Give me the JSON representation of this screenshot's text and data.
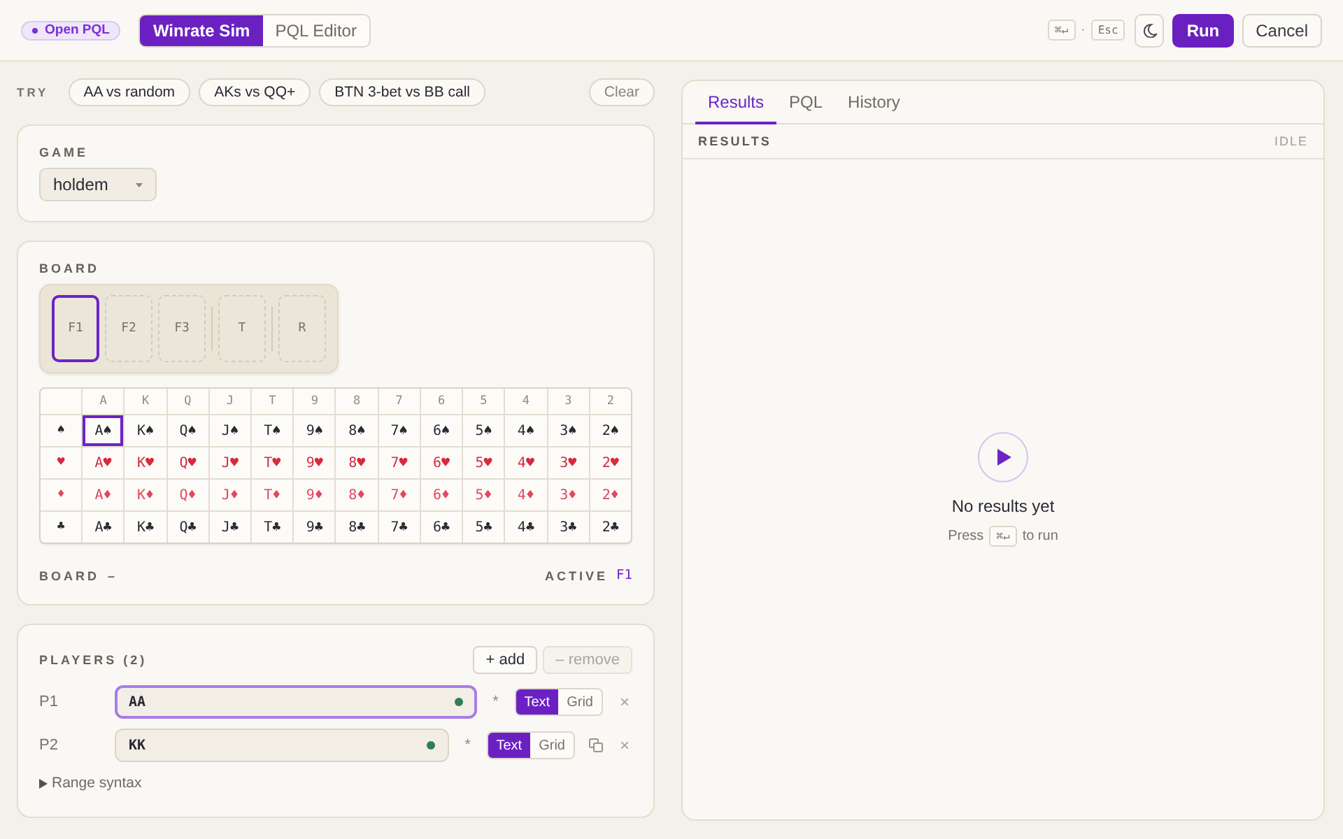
{
  "header": {
    "badge": {
      "label": "Open PQL"
    },
    "modes": [
      {
        "label": "Winrate Sim",
        "selected": true
      },
      {
        "label": "PQL Editor",
        "selected": false
      }
    ],
    "shortcuts": [
      "⌘↵",
      "Esc"
    ],
    "shortcut_separator": "·",
    "run_button": "Run",
    "cancel_button": "Cancel"
  },
  "try": {
    "label": "TRY",
    "examples": [
      "AA vs random",
      "AKs vs QQ+",
      "BTN 3-bet vs BB call"
    ],
    "clear_button": "Clear"
  },
  "game": {
    "label": "GAME",
    "value": "holdem"
  },
  "board": {
    "label": "BOARD",
    "slot_groups": [
      {
        "slots": [
          {
            "label": "F1",
            "selected": true
          },
          {
            "label": "F2",
            "selected": false
          },
          {
            "label": "F3",
            "selected": false
          }
        ]
      },
      {
        "slots": [
          {
            "label": "T",
            "selected": false
          }
        ]
      },
      {
        "slots": [
          {
            "label": "R",
            "selected": false
          }
        ]
      }
    ],
    "card_grid": {
      "columns": [
        "A",
        "K",
        "Q",
        "J",
        "T",
        "9",
        "8",
        "7",
        "6",
        "5",
        "4",
        "3",
        "2"
      ],
      "rows": [
        {
          "suit": "♠",
          "color": "#2b2a33",
          "cards": [
            {
              "label": "A♠",
              "selected": true
            },
            {
              "label": "K♠",
              "selected": false
            },
            {
              "label": "Q♠",
              "selected": false
            },
            {
              "label": "J♠",
              "selected": false
            },
            {
              "label": "T♠",
              "selected": false
            },
            {
              "label": "9♠",
              "selected": false
            },
            {
              "label": "8♠",
              "selected": false
            },
            {
              "label": "7♠",
              "selected": false
            },
            {
              "label": "6♠",
              "selected": false
            },
            {
              "label": "5♠",
              "selected": false
            },
            {
              "label": "4♠",
              "selected": false
            },
            {
              "label": "3♠",
              "selected": false
            },
            {
              "label": "2♠",
              "selected": false
            }
          ]
        },
        {
          "suit": "♥",
          "color": "#d6293f",
          "cards": [
            {
              "label": "A♥",
              "selected": false
            },
            {
              "label": "K♥",
              "selected": false
            },
            {
              "label": "Q♥",
              "selected": false
            },
            {
              "label": "J♥",
              "selected": false
            },
            {
              "label": "T♥",
              "selected": false
            },
            {
              "label": "9♥",
              "selected": false
            },
            {
              "label": "8♥",
              "selected": false
            },
            {
              "label": "7♥",
              "selected": false
            },
            {
              "label": "6♥",
              "selected": false
            },
            {
              "label": "5♥",
              "selected": false
            },
            {
              "label": "4♥",
              "selected": false
            },
            {
              "label": "3♥",
              "selected": false
            },
            {
              "label": "2♥",
              "selected": false
            }
          ]
        },
        {
          "suit": "♦",
          "color": "#e2475d",
          "cards": [
            {
              "label": "A♦",
              "selected": false
            },
            {
              "label": "K♦",
              "selected": false
            },
            {
              "label": "Q♦",
              "selected": false
            },
            {
              "label": "J♦",
              "selected": false
            },
            {
              "label": "T♦",
              "selected": false
            },
            {
              "label": "9♦",
              "selected": false
            },
            {
              "label": "8♦",
              "selected": false
            },
            {
              "label": "7♦",
              "selected": false
            },
            {
              "label": "6♦",
              "selected": false
            },
            {
              "label": "5♦",
              "selected": false
            },
            {
              "label": "4♦",
              "selected": false
            },
            {
              "label": "3♦",
              "selected": false
            },
            {
              "label": "2♦",
              "selected": false
            }
          ]
        },
        {
          "suit": "♣",
          "color": "#2b2a33",
          "cards": [
            {
              "label": "A♣",
              "selected": false
            },
            {
              "label": "K♣",
              "selected": false
            },
            {
              "label": "Q♣",
              "selected": false
            },
            {
              "label": "J♣",
              "selected": false
            },
            {
              "label": "T♣",
              "selected": false
            },
            {
              "label": "9♣",
              "selected": false
            },
            {
              "label": "8♣",
              "selected": false
            },
            {
              "label": "7♣",
              "selected": false
            },
            {
              "label": "6♣",
              "selected": false
            },
            {
              "label": "5♣",
              "selected": false
            },
            {
              "label": "4♣",
              "selected": false
            },
            {
              "label": "3♣",
              "selected": false
            },
            {
              "label": "2♣",
              "selected": false
            }
          ]
        }
      ]
    },
    "summary": {
      "label": "BOARD",
      "value": "–"
    },
    "active": {
      "label": "ACTIVE",
      "value": "F1"
    }
  },
  "players": {
    "title": "PLAYERS (2)",
    "add_button": "+ add",
    "remove_button": {
      "label": "– remove",
      "disabled": true
    },
    "rows": [
      {
        "label": "P1",
        "value": "AA",
        "focused": true,
        "valid": true,
        "marker": "*",
        "modes": [
          {
            "label": "Text",
            "selected": true
          },
          {
            "label": "Grid",
            "selected": false
          }
        ],
        "copy_button": false,
        "remove": {
          "label": "×",
          "disabled": true
        }
      },
      {
        "label": "P2",
        "value": "KK",
        "focused": false,
        "valid": true,
        "marker": "*",
        "modes": [
          {
            "label": "Text",
            "selected": true
          },
          {
            "label": "Grid",
            "selected": false
          }
        ],
        "copy_button": true,
        "remove": {
          "label": "×",
          "disabled": true
        }
      }
    ],
    "range_syntax": {
      "label": "Range syntax",
      "expanded": false
    }
  },
  "results": {
    "tabs": [
      {
        "label": "Results",
        "selected": true
      },
      {
        "label": "PQL",
        "selected": false
      },
      {
        "label": "History",
        "selected": false
      }
    ],
    "section_label": "RESULTS",
    "status": "IDLE",
    "empty": {
      "title": "No results yet",
      "hint_before": "Press",
      "hint_key": "⌘↵",
      "hint_after": "to run"
    }
  }
}
